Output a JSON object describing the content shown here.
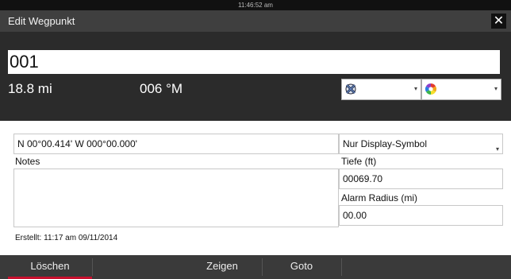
{
  "status": {
    "time": "11:46:52 am"
  },
  "title": {
    "text": "Edit Wegpunkt",
    "close_glyph": "✕"
  },
  "waypoint": {
    "name": "001",
    "distance": "18.8 mi",
    "bearing": "006 °M"
  },
  "symbol_select": {
    "icon": "waypoint-cross-icon",
    "caret": "▾"
  },
  "color_select": {
    "icon": "color-wheel-icon",
    "caret": "▾"
  },
  "position": {
    "value": "N 00°00.414'   W 000°00.000'"
  },
  "display_select": {
    "value": "Nur Display-Symbol",
    "caret": "▾"
  },
  "notes": {
    "label": "Notes",
    "value": ""
  },
  "depth": {
    "label": "Tiefe (ft)",
    "value": "00069.70"
  },
  "alarm_radius": {
    "label": "Alarm Radius (mi)",
    "value": "00.00"
  },
  "created": {
    "text": "Erstellt: 11:17 am  09/11/2014"
  },
  "actions": {
    "delete": "Löschen",
    "show": "Zeigen",
    "goto": "Goto"
  },
  "colors": {
    "accent": "#c8102e",
    "title_bg": "#3f3f3f",
    "panel_dark": "#2b2b2b"
  }
}
